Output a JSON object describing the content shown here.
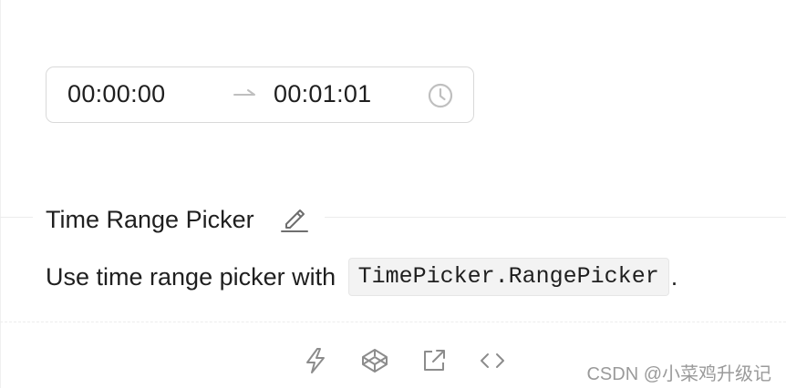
{
  "picker": {
    "start_value": "00:00:00",
    "end_value": "00:01:01",
    "separator_icon": "arrow-right-icon",
    "suffix_icon": "clock-icon"
  },
  "section": {
    "title": "Time Range Picker",
    "edit_icon": "edit-icon",
    "description_prefix": "Use time range picker with",
    "description_code": "TimePicker.RangePicker",
    "description_suffix": "."
  },
  "actions": [
    {
      "icon": "thunderbolt-icon"
    },
    {
      "icon": "codepen-icon"
    },
    {
      "icon": "external-link-icon"
    },
    {
      "icon": "code-icon"
    }
  ],
  "watermark": "CSDN @小菜鸡升级记",
  "colors": {
    "border": "#d9d9d9",
    "icon": "#8c8c8c",
    "text": "#1f1f1f",
    "code_bg": "#f3f3f3"
  }
}
